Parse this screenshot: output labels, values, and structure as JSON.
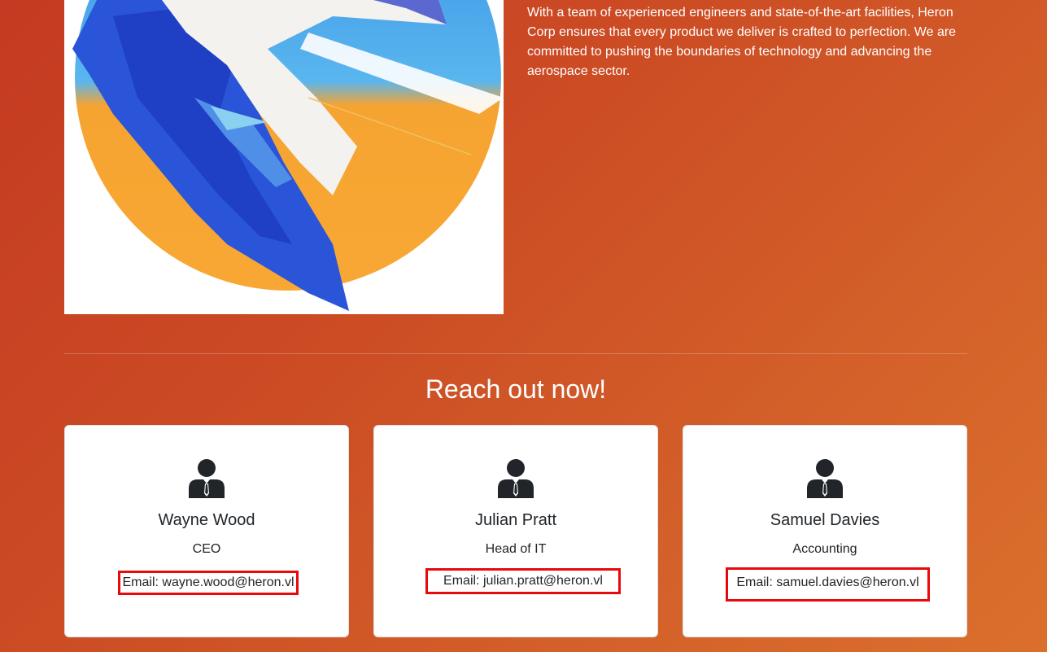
{
  "about": {
    "text": "With a team of experienced engineers and state-of-the-art facilities, Heron Corp ensures that every product we deliver is crafted to perfection. We are committed to pushing the boundaries of technology and advancing the aerospace sector."
  },
  "contact": {
    "title": "Reach out now!",
    "people": [
      {
        "name": "Wayne Wood",
        "role": "CEO",
        "email_prefix": "Email: ",
        "email": "wayne.wood@heron.vl"
      },
      {
        "name": "Julian Pratt",
        "role": "Head of IT",
        "email_prefix": "Email: ",
        "email": "julian.pratt@heron.vl"
      },
      {
        "name": "Samuel Davies",
        "role": "Accounting",
        "email_prefix": "Email: ",
        "email": "samuel.davies@heron.vl"
      }
    ]
  },
  "colors": {
    "background_start": "#c43a22",
    "background_end": "#db6f2c",
    "highlight_border": "#e8090c",
    "card_text": "#212529"
  },
  "icons": {
    "logo": "heron-logo",
    "person": "user-tie-icon"
  }
}
